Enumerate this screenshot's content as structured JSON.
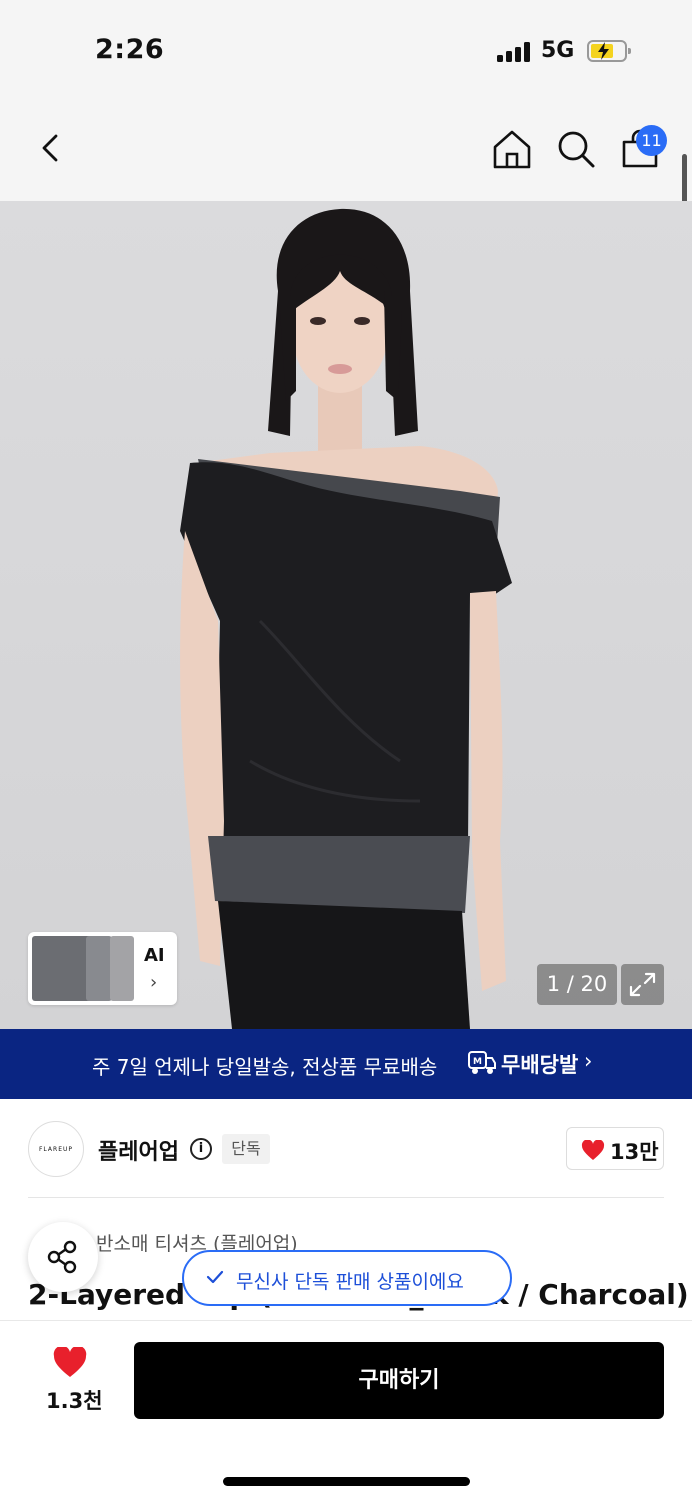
{
  "status_bar": {
    "time": "2:26",
    "network": "5G",
    "battery_color": "#f4d31f"
  },
  "nav": {
    "back_icon": "chevron-left-icon",
    "home_icon": "home-icon",
    "search_icon": "search-icon",
    "cart_icon": "shopping-bag-icon",
    "cart_count": "11",
    "badge_color": "#2a6cf6"
  },
  "gallery": {
    "current": "1 / 20",
    "ai_label": "AI",
    "ai_chevron": "›",
    "expand_icon": "expand-icon"
  },
  "banner": {
    "text": "주 7일 언제나 당일발송, 전상품 무료배송",
    "brand": "무배당발",
    "chevron": "›",
    "color": "#0a2582"
  },
  "brand": {
    "logo_text": "FLAREUP",
    "name": "플레어업",
    "tag": "단독",
    "likes": "13만"
  },
  "product": {
    "category_prefix": "반소매 티셔츠 (플레어업)",
    "title": "2-Layered Top (Charcoal_Black / Charcoal)"
  },
  "toast": {
    "message": "무신사 단독 판매 상품이에요"
  },
  "bottom": {
    "wish_count": "1.3천",
    "buy_label": "구매하기"
  }
}
